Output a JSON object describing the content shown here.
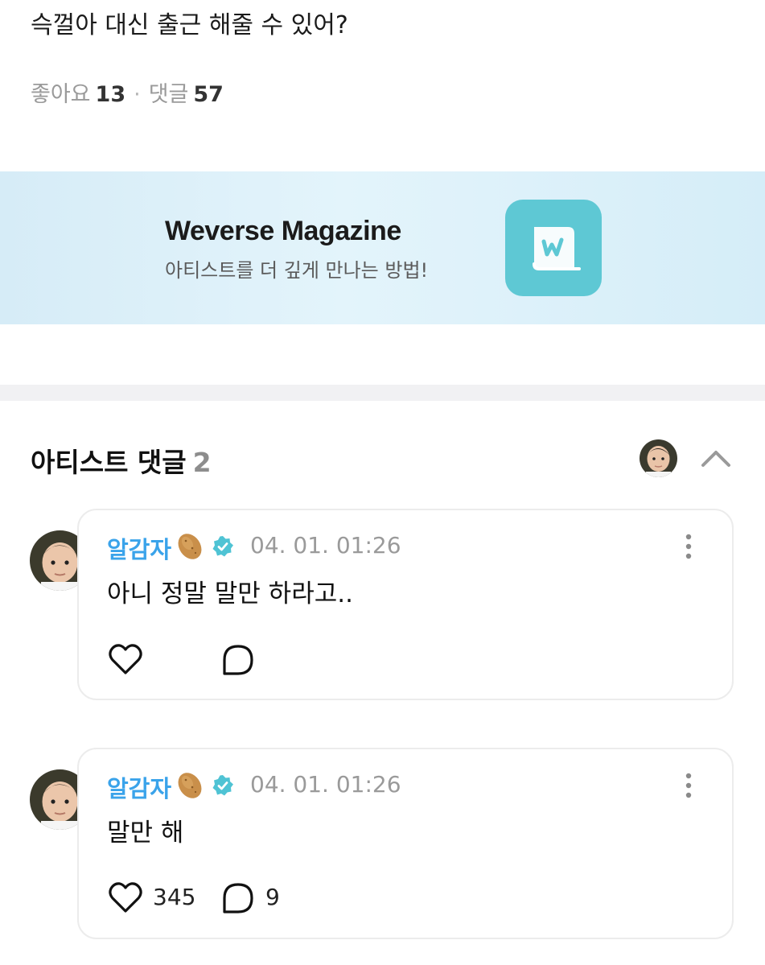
{
  "post": {
    "text": "슥껄아 대신 출근 해줄 수 있어?",
    "likes_label": "좋아요",
    "likes_count": "13",
    "separator": "·",
    "comments_label": "댓글",
    "comments_count": "57"
  },
  "banner": {
    "title": "Weverse Magazine",
    "subtitle": "아티스트를 더 깊게 만나는 방법!",
    "icon": "weverse-magazine-icon",
    "app_color": "#5ec8d4"
  },
  "artist_comments": {
    "title": "아티스트 댓글",
    "count": "2",
    "toggle_icon": "chevron-up-icon"
  },
  "comments": [
    {
      "author": "알감자",
      "author_emoji_icon": "potato-icon",
      "verified_icon": "verified-badge-icon",
      "time": "04. 01. 01:26",
      "text": "아니 정말 말만 하라고..",
      "likes": "",
      "replies": ""
    },
    {
      "author": "알감자",
      "author_emoji_icon": "potato-icon",
      "verified_icon": "verified-badge-icon",
      "time": "04. 01. 01:26",
      "text": "말만 해",
      "likes": "345",
      "replies": "9"
    }
  ],
  "colors": {
    "accent_name": "#3aa3ea",
    "verified": "#4fc3d4",
    "muted": "#9a9a9a"
  }
}
